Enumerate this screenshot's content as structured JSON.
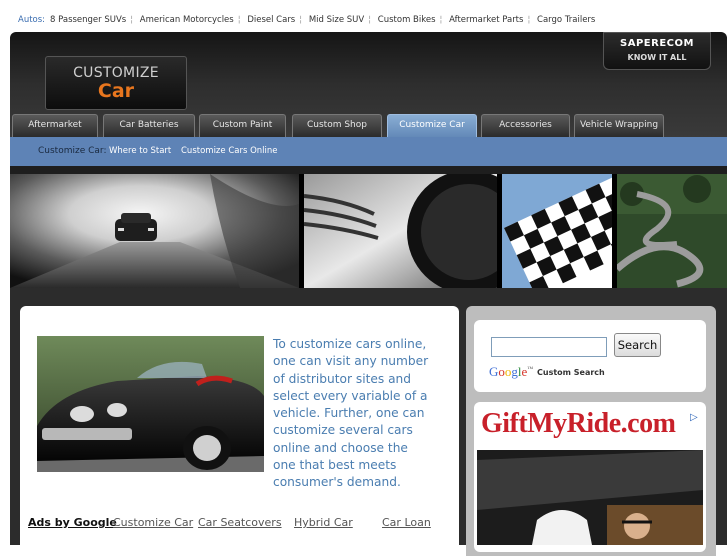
{
  "topbar": {
    "autos_label": "Autos:",
    "links": [
      "8 Passenger SUVs",
      "American Motorcycles",
      "Diesel Cars",
      "Mid Size SUV",
      "Custom Bikes",
      "Aftermarket Parts",
      "Cargo Trailers"
    ]
  },
  "logo": {
    "line1": "CUSTOMIZE",
    "line2": "Car"
  },
  "saperecom": {
    "brand": "SAPERECOM",
    "tagline": "KNOW IT ALL"
  },
  "nav": {
    "tabs": [
      "Aftermarket",
      "Car Batteries",
      "Custom Paint",
      "Custom Shop",
      "Customize Car",
      "Accessories",
      "Vehicle Wrapping"
    ],
    "active": "Customize Car"
  },
  "subnav": {
    "label": "Customize Car:",
    "links": [
      "Where to Start",
      "Customize Cars Online"
    ]
  },
  "main": {
    "description": "To customize cars online, one can visit any number of distributor sites and select every variable of a vehicle.  Further, one can customize several cars online and choose the one that best meets consumer's demand."
  },
  "ads": {
    "ads_by": "Ads by Google",
    "links": [
      "Customize Car",
      "Car Seatcovers",
      "Hybrid Car",
      "Car Loan"
    ]
  },
  "search": {
    "input_value": "",
    "button_label": "Search",
    "custom_search_label": "Custom Search",
    "google_letters": [
      "G",
      "o",
      "o",
      "g",
      "l",
      "e"
    ],
    "tm": "™"
  },
  "sidebar_ad": {
    "title": "GiftMyRide.com"
  },
  "colors": {
    "accent_blue": "#5e83b6",
    "active_tab": "#7aa0cc",
    "header_dark": "#2e2e2e",
    "logo_orange": "#e8761e",
    "ad_red": "#c8202a",
    "text_blue": "#4a7db0"
  },
  "icons": {
    "adchoice": "adchoices-icon"
  }
}
